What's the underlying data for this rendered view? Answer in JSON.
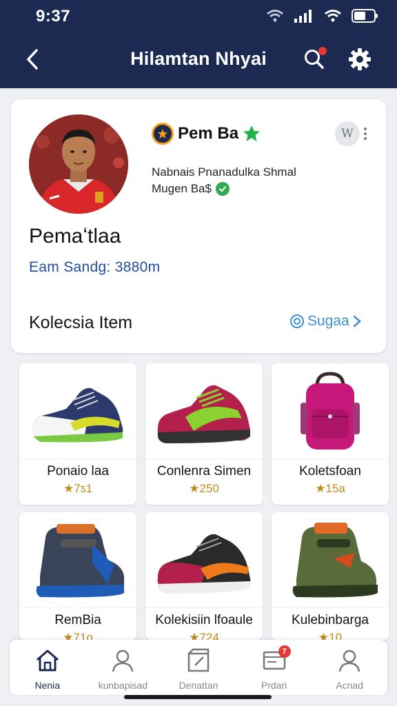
{
  "status_bar": {
    "time": "9:37"
  },
  "header": {
    "title": "Hilamtan Nhyai"
  },
  "profile": {
    "badge_name": "Pem Ba",
    "subtitle_line1": "Nabnais Pnanadulka Shmal",
    "subtitle_line2": "Mugen Ba$",
    "player_name": "Pemaʻtlaa",
    "earnings": "Eam Sandg: 3880m",
    "more_button_label": "W"
  },
  "collection": {
    "title": "Kolecsia Item",
    "see_all_label": "Sugaa"
  },
  "items": [
    {
      "name": "Ponaio laa",
      "price": "★7ƽ1",
      "kind": "shoe",
      "colors": [
        "#f5f5f5",
        "#2d3a6e",
        "#7ac943",
        "#d7dc2b"
      ]
    },
    {
      "name": "Conlenra Simen",
      "price": "★250",
      "kind": "shoe",
      "colors": [
        "#b3204b",
        "#333",
        "#8bd12f",
        "#8bd12f"
      ]
    },
    {
      "name": "Koletsfoan",
      "price": "★15a",
      "kind": "bag",
      "colors": [
        "#c5187a",
        "#7a1250",
        "#3a2a2a",
        "#9c3a78"
      ]
    },
    {
      "name": "RemBia",
      "price": "★71o",
      "kind": "boot",
      "colors": [
        "#3a4459",
        "#1f5cb8",
        "#d9712b",
        "#1f5cb8"
      ]
    },
    {
      "name": "Kolekisiin lfoaule",
      "price": "★724",
      "kind": "shoe",
      "colors": [
        "#b3204b",
        "#2a2a2a",
        "#f07a1a",
        "#eee"
      ]
    },
    {
      "name": "Kulebinbarga",
      "price": "★10",
      "kind": "boot",
      "colors": [
        "#5a6b3a",
        "#2e3a1f",
        "#e0692a",
        "#d84a1a"
      ]
    }
  ],
  "bottom_nav": [
    {
      "label": "Nenia",
      "icon": "home-icon"
    },
    {
      "label": "kunbapisad",
      "icon": "profile-icon"
    },
    {
      "label": "Denattan",
      "icon": "box-icon"
    },
    {
      "label": "Prdari",
      "icon": "message-icon",
      "badge": "7"
    },
    {
      "label": "Acnad",
      "icon": "account-icon"
    }
  ],
  "colors": {
    "header_bg": "#1c2a52",
    "accent_blue": "#3d8fd6",
    "earnings_blue": "#1f4d9e",
    "star_gold": "#c28a1a",
    "verify_green": "#34a853",
    "notif_red": "#e53935"
  }
}
